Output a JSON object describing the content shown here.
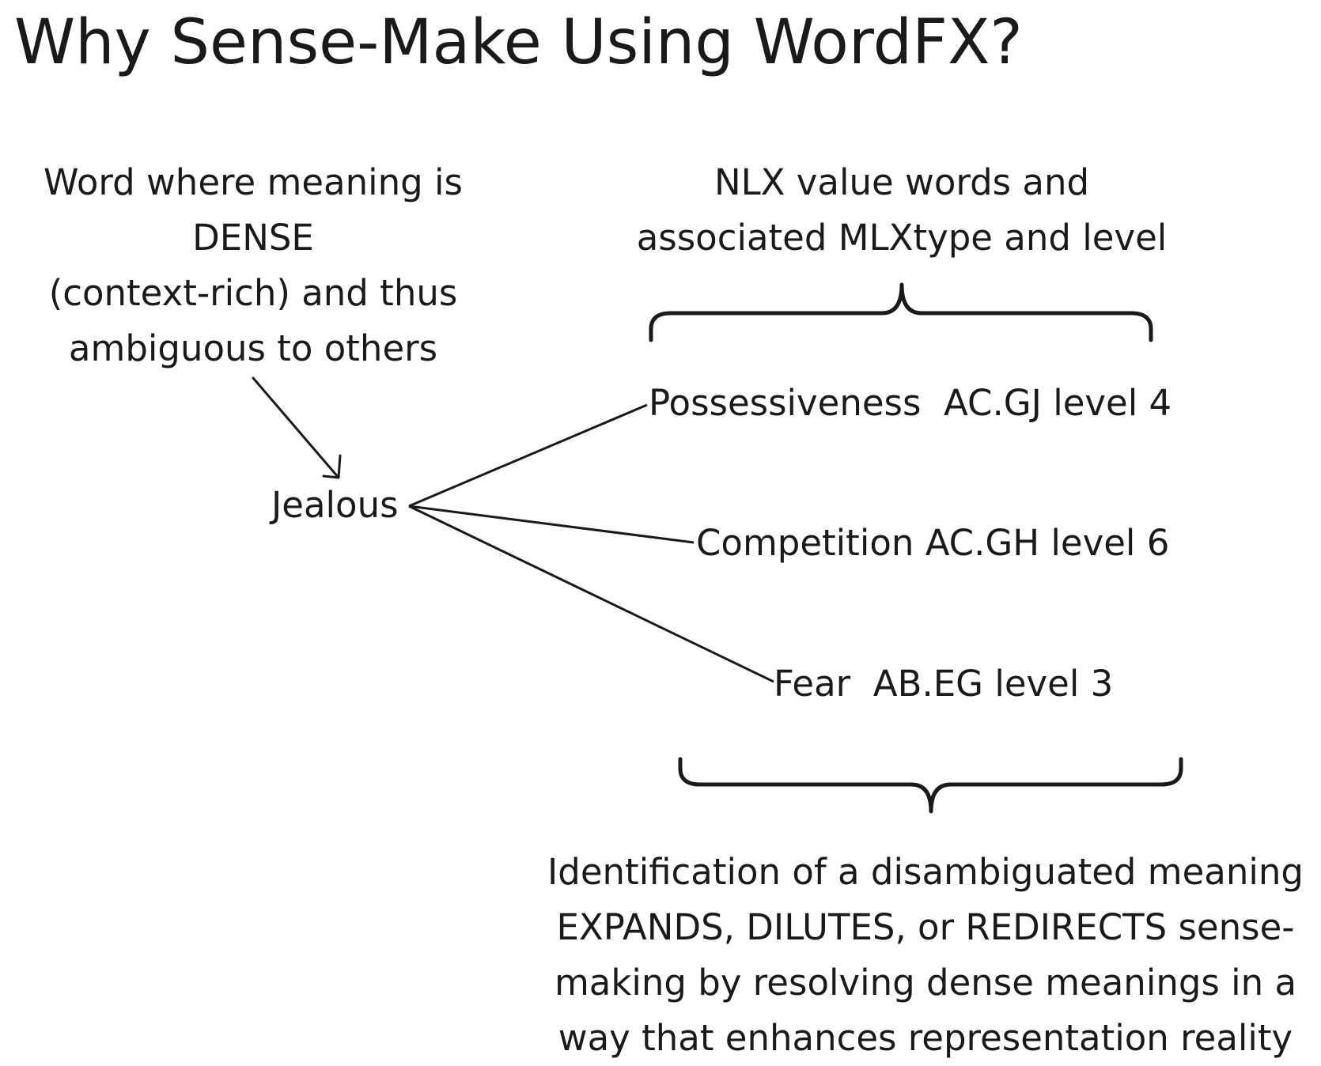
{
  "title": "Why Sense-Make Using WordFX?",
  "left_caption": [
    "Word where meaning is",
    "DENSE",
    "(context-rich) and thus",
    "ambiguous to others"
  ],
  "top_caption": [
    "NLX value words and",
    "associated MLXtype and level"
  ],
  "center_word": "Jealous",
  "branches": [
    "Possessiveness  AC.GJ level 4",
    "Competition AC.GH level 6",
    "Fear  AB.EG level 3"
  ],
  "bottom_caption": [
    "Identification of a disambiguated meaning",
    "EXPANDS, DILUTES, or REDIRECTS sense-",
    "making by resolving dense meanings in a",
    "way that enhances representation reality"
  ]
}
